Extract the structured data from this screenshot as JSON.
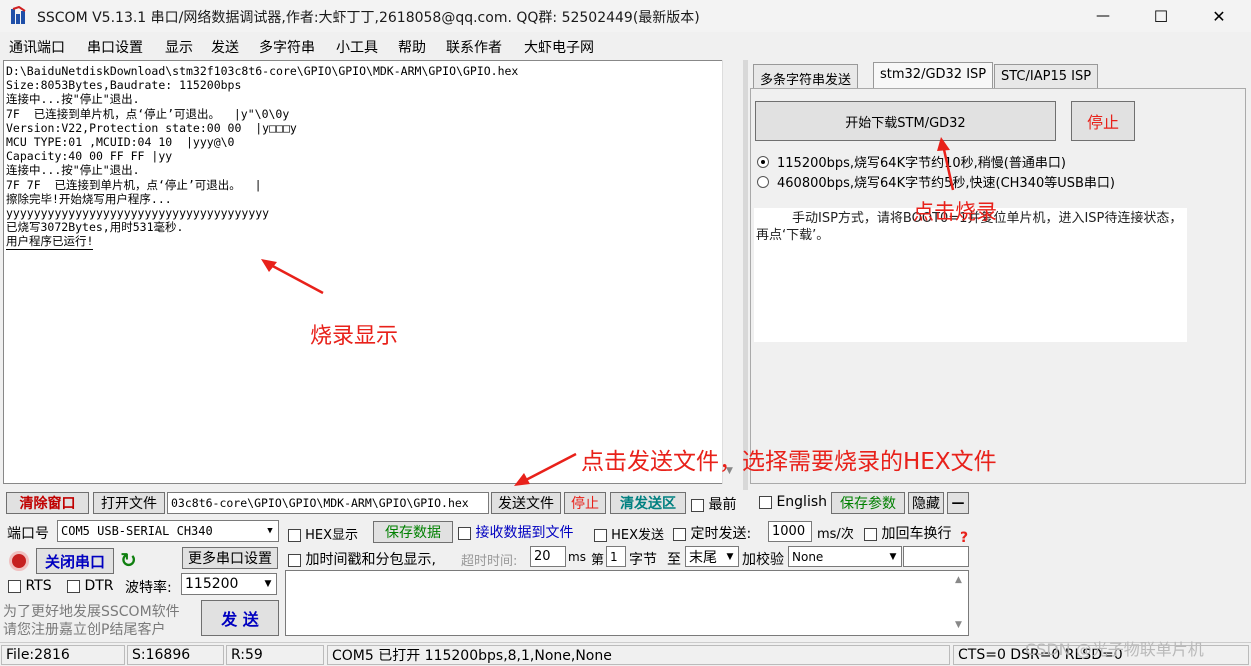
{
  "window": {
    "title": "SSCOM V5.13.1 串口/网络数据调试器,作者:大虾丁丁,2618058@qq.com. QQ群:  52502449(最新版本)",
    "minimize": "—",
    "maximize": "☐",
    "close": "✕"
  },
  "menu": [
    "通讯端口",
    "串口设置",
    "显示",
    "发送",
    "多字符串",
    "小工具",
    "帮助",
    "联系作者",
    "大虾电子网"
  ],
  "receive": {
    "lines": [
      "D:\\BaiduNetdiskDownload\\stm32f103c8t6-core\\GPIO\\GPIO\\MDK-ARM\\GPIO\\GPIO.hex",
      "Size:8053Bytes,Baudrate: 115200bps",
      "连接中...按\"停止\"退出.",
      "7F  已连接到单片机，点‘停止’可退出。  |y\"\\0\\0y",
      "Version:V22,Protection state:00 00  |y□□□y",
      "MCU TYPE:01 ,MCUID:04 10  |yyy@\\0",
      "Capacity:40 00 FF FF |yy",
      "连接中...按\"停止\"退出.",
      "7F 7F  已连接到单片机，点‘停止’可退出。  |",
      "擦除完毕!开始烧写用户程序...",
      "yyyyyyyyyyyyyyyyyyyyyyyyyyyyyyyyyyyyyy",
      "已烧写3072Bytes,用时531毫秒.",
      "用户程序已运行!"
    ]
  },
  "tabs": [
    "多条字符串发送",
    "stm32/GD32 ISP",
    "STC/IAP15 ISP"
  ],
  "isp": {
    "download_button": "开始下载STM/GD32",
    "stop_button": "停止",
    "options": [
      "115200bps,烧写64K字节约10秒,稍慢(普通串口)",
      "460800bps,烧写64K字节约5秒,快速(CH340等USB串口)"
    ],
    "description": "手动ISP方式，请将BOOT0=1并复位单片机，进入ISP待连接状态，再点‘下载’。"
  },
  "annotations": {
    "burn_display": "烧录显示",
    "click_burn": "点击烧录",
    "send_file": "点击发送文件，选择需要烧录的HEX文件"
  },
  "toolbar": {
    "clear_window": "清除窗口",
    "open_file": "打开文件",
    "file_path": "03c8t6-core\\GPIO\\GPIO\\MDK-ARM\\GPIO\\GPIO.hex",
    "send_file": "发送文件",
    "stop": "停止",
    "clear_send": "清发送区",
    "topmost": "最前",
    "english": "English",
    "save_params": "保存参数",
    "hide": "隐藏",
    "collapse": "—"
  },
  "settings": {
    "port_label": "端口号",
    "port_value": "COM5 USB-SERIAL CH340",
    "hex_display": "HEX显示",
    "save_data": "保存数据",
    "recv_to_file": "接收数据到文件",
    "hex_send": "HEX发送",
    "timed_send": "定时发送:",
    "timed_value": "1000",
    "timed_unit": "ms/次",
    "add_crlf": "加回车换行",
    "close_port": "关闭串口",
    "more_settings": "更多串口设置",
    "timestamp": "加时间戳和分包显示,",
    "timeout_label": "超时时间:",
    "timeout_value": "20",
    "ms": "ms",
    "nth": "第",
    "byte_index": "1",
    "byte_unit": "字节",
    "to": "至",
    "end_value": "末尾",
    "checksum": "加校验",
    "checksum_value": "None",
    "rts": "RTS",
    "dtr": "DTR",
    "baud_label": "波特率:",
    "baud_value": "115200",
    "promo_line1": "为了更好地发展SSCOM软件",
    "promo_line2": "请您注册嘉立创P结尾客户",
    "send": "发 送"
  },
  "status": {
    "file": "File:2816",
    "sent": "S:16896",
    "recv": "R:59",
    "port_state": "COM5 已打开  115200bps,8,1,None,None",
    "lines": "CTS=0 DSR=0 RLSD=0",
    "watermark": "CSDN @光子物联单片机"
  },
  "colors": {
    "annotation": "#e8211a",
    "clear_window_text": "#c00000",
    "save_green": "#008000",
    "link_blue": "#0000c0"
  }
}
